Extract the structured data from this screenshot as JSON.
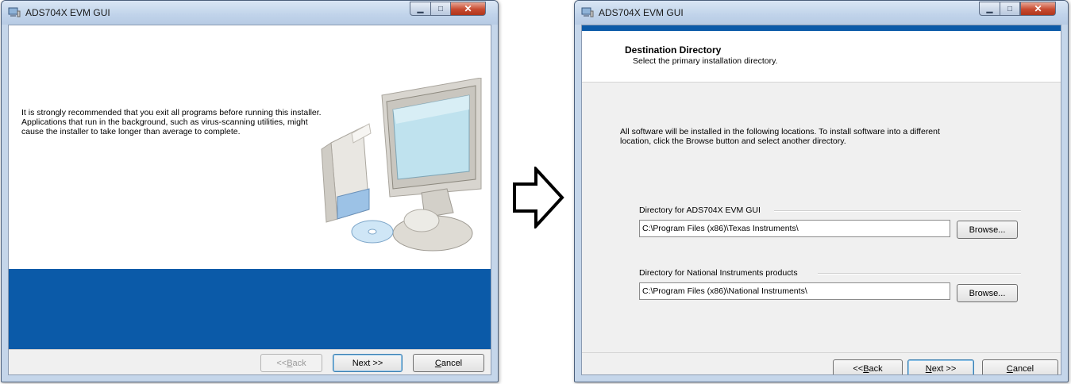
{
  "window1": {
    "title": "ADS704X EVM GUI",
    "intro_text": "It is strongly recommended that you exit all programs before running this installer. Applications that run in the background, such as virus-scanning utilities, might cause the installer to take longer than average to complete.",
    "buttons": {
      "back": {
        "pre": "<< ",
        "accel": "B",
        "post": "ack"
      },
      "next": "Next >>",
      "cancel": {
        "accel": "C",
        "post": "ancel"
      }
    }
  },
  "window2": {
    "title": "ADS704X EVM GUI",
    "header_title": "Destination Directory",
    "header_subtitle": "Select the primary installation directory.",
    "info_text": "All software will be installed in the following locations. To install software into a different location, click the Browse button and select another directory.",
    "groups": [
      {
        "label": "Directory for ADS704X EVM GUI",
        "path": "C:\\Program Files (x86)\\Texas Instruments\\",
        "browse": "Browse..."
      },
      {
        "label": "Directory for National Instruments products",
        "path": "C:\\Program Files (x86)\\National Instruments\\",
        "browse": "Browse..."
      }
    ],
    "buttons": {
      "back": {
        "pre": "<< ",
        "accel": "B",
        "post": "ack"
      },
      "next": {
        "accel": "N",
        "post": "ext >>"
      },
      "cancel": {
        "accel": "C",
        "post": "ancel"
      }
    }
  },
  "icons": {
    "window_controls": [
      "minimize-icon",
      "maximize-icon",
      "close-icon"
    ],
    "flow": "right-arrow-icon"
  },
  "colors": {
    "banner_blue": "#0b5aa8",
    "dialog_gray": "#f0f0f0",
    "close_red": "#c74a30",
    "frame_blue": "#c5d6ea"
  }
}
